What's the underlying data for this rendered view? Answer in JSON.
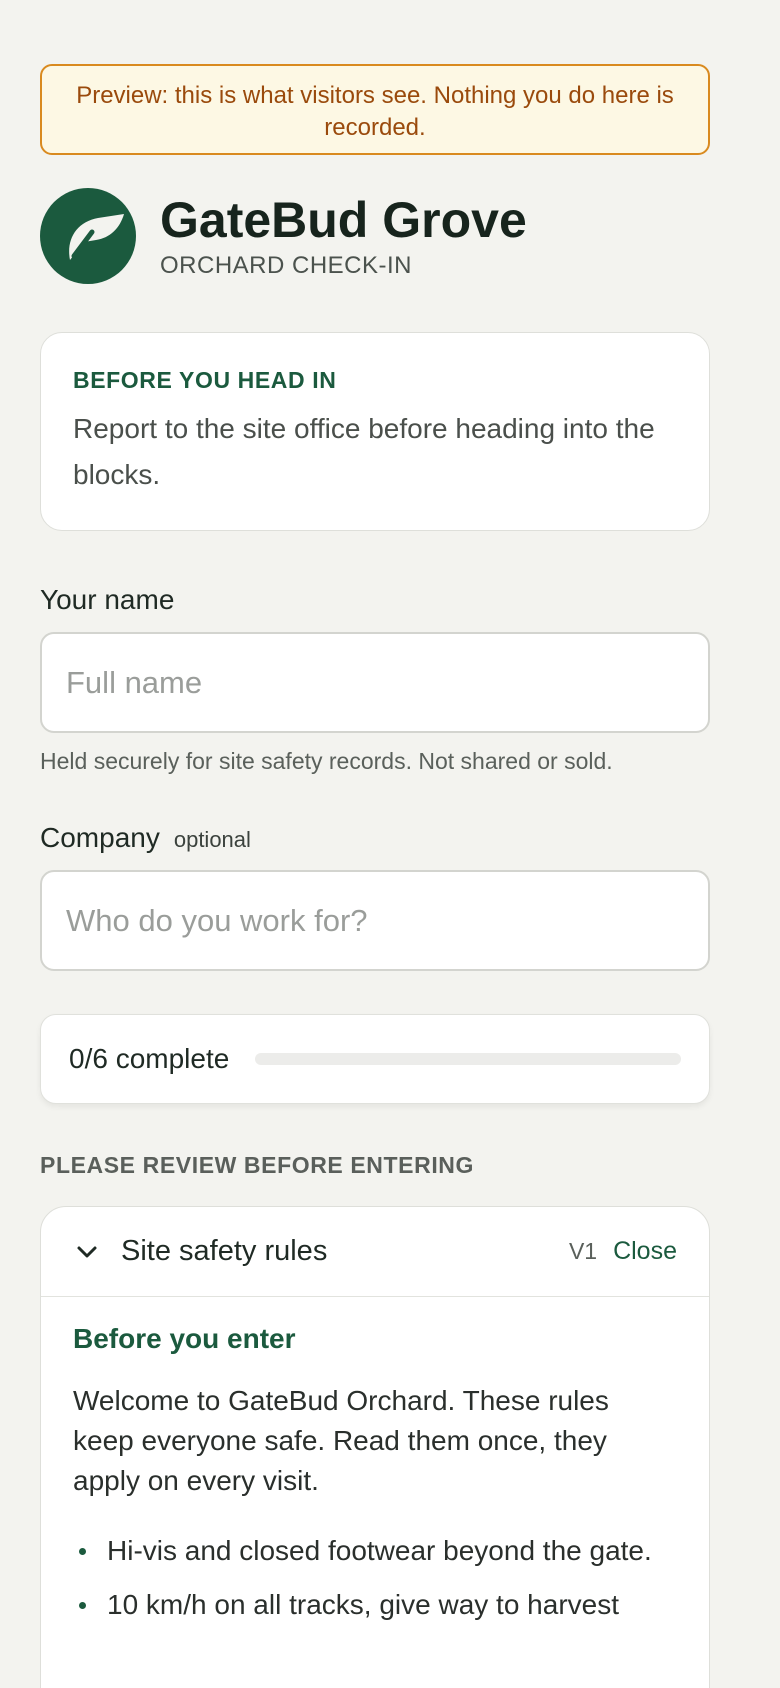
{
  "banner": {
    "text": "Preview: this is what visitors see. Nothing you do here is recorded."
  },
  "brand": {
    "logo_icon": "leaf-logo-icon",
    "title": "GateBud Grove",
    "subtitle": "ORCHARD CHECK-IN",
    "color": "#1b5a3e"
  },
  "notice": {
    "title": "BEFORE YOU HEAD IN",
    "body": "Report to the site office before heading into the blocks."
  },
  "form": {
    "name": {
      "label": "Your name",
      "placeholder": "Full name",
      "value": "",
      "hint": "Held securely for site safety records. Not shared or sold."
    },
    "company": {
      "label": "Company",
      "optional_tag": "optional",
      "placeholder": "Who do you work for?",
      "value": ""
    }
  },
  "progress": {
    "label": "0/6 complete",
    "completed": 0,
    "total": 6
  },
  "review": {
    "heading": "PLEASE REVIEW BEFORE ENTERING",
    "card": {
      "chevron_icon": "chevron-down-icon",
      "title": "Site safety rules",
      "version": "V1",
      "close_label": "Close",
      "subtitle": "Before you enter",
      "intro": "Welcome to GateBud Orchard. These rules keep everyone safe. Read them once, they apply on every visit.",
      "rules": [
        "Hi-vis and closed footwear beyond the gate.",
        "10 km/h on all tracks, give way to harvest"
      ]
    }
  }
}
